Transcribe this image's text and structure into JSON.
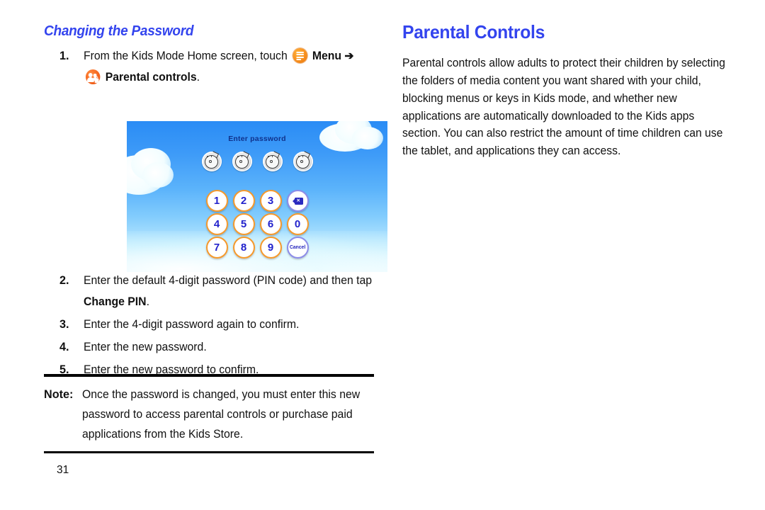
{
  "page": {
    "number": "31"
  },
  "left_column": {
    "section_heading": "Changing the Password",
    "steps": [
      {
        "number": "1.",
        "text_before_menu_icon": "From the Kids Mode Home screen, touch",
        "menu_label": "Menu",
        "arrow": "➔",
        "parental_label": "Parental controls",
        "period": "."
      },
      {
        "number": "2.",
        "text_part1": "Enter the default 4-digit password (PIN code) and then tap ",
        "bold_part": "Change PIN",
        "text_part2": "."
      },
      {
        "number": "3.",
        "text": "Enter the 4-digit password again to confirm."
      },
      {
        "number": "4.",
        "text": "Enter the new password."
      },
      {
        "number": "5.",
        "text": "Enter the new password to confirm."
      }
    ],
    "note": {
      "label": "Note:",
      "text": "Once the password is changed, you must enter this new password to access parental controls or purchase paid applications from the Kids Store."
    }
  },
  "right_column": {
    "chapter_heading": "Parental Controls",
    "paragraph": "Parental controls allow adults to protect their children by selecting the folders of media content you want shared with your child, blocking menus or keys in Kids mode, and whether new applications are automatically downloaded to the Kids apps section. You can also restrict the amount of time children can use the tablet, and applications they can access."
  },
  "screenshot": {
    "title": "Enter password",
    "password_dots_count": 4,
    "keypad": {
      "rows": [
        [
          "1",
          "2",
          "3",
          "backspace"
        ],
        [
          "4",
          "5",
          "6",
          "0"
        ],
        [
          "7",
          "8",
          "9",
          "Cancel"
        ]
      ],
      "cancel_label": "Cancel"
    },
    "colors": {
      "sky_top": "#2a8cf5",
      "sky_bottom": "#e4f9ff",
      "key_ring": "#f5992c",
      "key_digit": "#2222cc",
      "alt_key_ring": "#8c8ce8",
      "title_text": "#10328c"
    }
  },
  "theme": {
    "heading_blue": "#3344ee",
    "icon_orange": "#f4631c",
    "body_text": "#111111"
  }
}
